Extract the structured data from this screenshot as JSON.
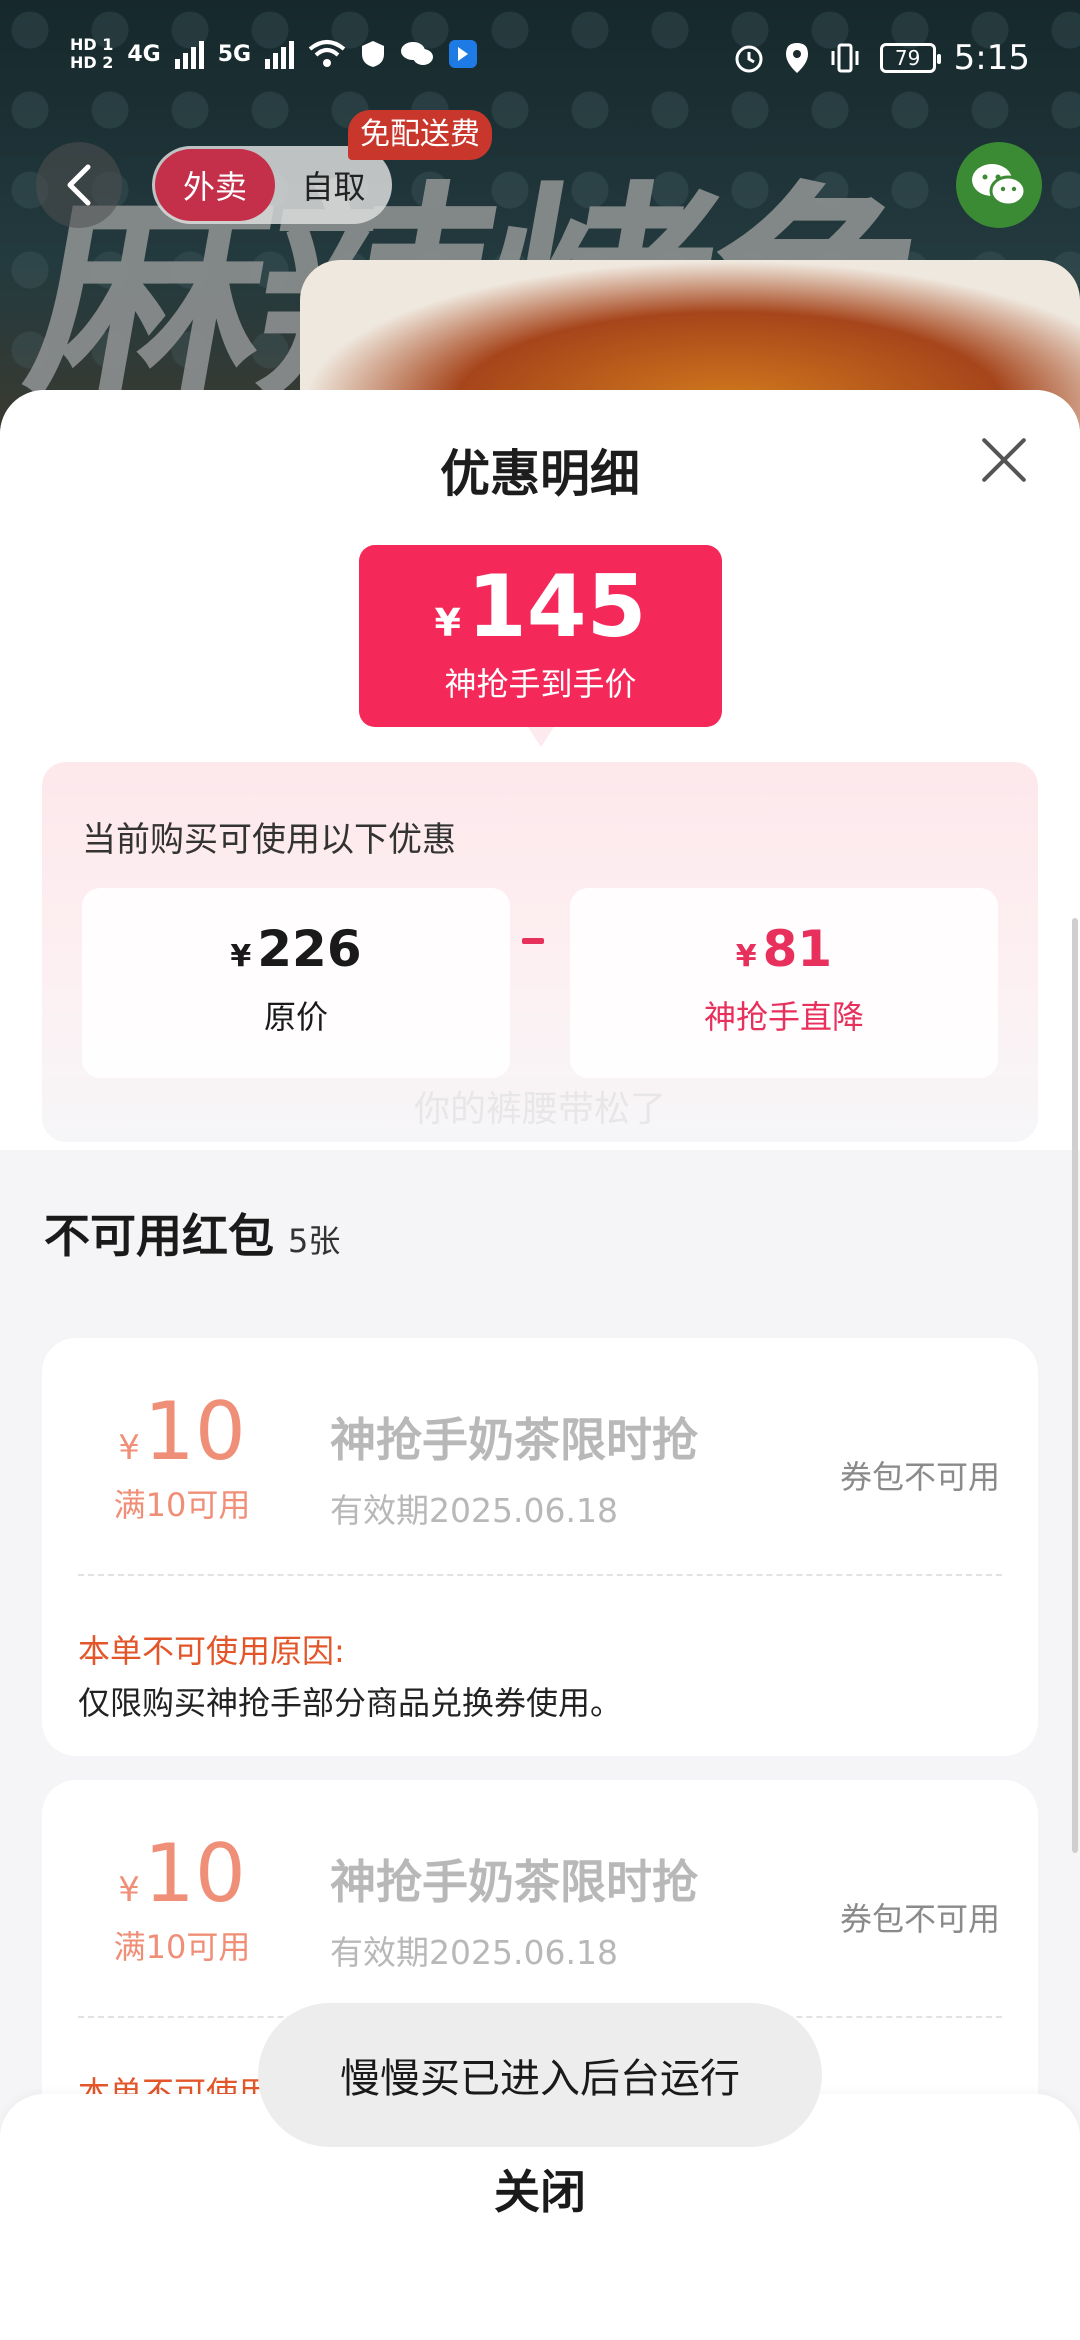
{
  "status_bar": {
    "left_labels": [
      "HD 1",
      "HD 2",
      "4G",
      "5G"
    ],
    "battery": "79",
    "time": "5:15"
  },
  "hero": {
    "title": "麻辣烤鱼",
    "mode_takeout": "外卖",
    "mode_pickup": "自取",
    "free_shipping": "免配送费"
  },
  "sheet": {
    "title": "优惠明细",
    "price": {
      "symbol": "¥",
      "amount": "145",
      "label": "神抢手到手价"
    },
    "benefits": {
      "title": "当前购买可使用以下优惠",
      "original": {
        "symbol": "¥",
        "value": "226",
        "label": "原价"
      },
      "discount": {
        "symbol": "¥",
        "value": "81",
        "label": "神抢手直降"
      }
    },
    "watermark": "你的裤腰带松了",
    "unavailable": {
      "title": "不可用红包",
      "count": "5张"
    },
    "coupons": [
      {
        "symbol": "¥",
        "amount": "10",
        "condition": "满10可用",
        "name": "神抢手奶茶限时抢",
        "validity": "有效期2025.06.18",
        "state": "券包不可用",
        "reason_title": "本单不可使用原因:",
        "reason": "仅限购买神抢手部分商品兑换券使用。"
      },
      {
        "symbol": "¥",
        "amount": "10",
        "condition": "满10可用",
        "name": "神抢手奶茶限时抢",
        "validity": "有效期2025.06.18",
        "state": "券包不可用",
        "reason_title": "本单不可使用原因:"
      }
    ],
    "close_button": "关闭"
  },
  "toast": "慢慢买已进入后台运行"
}
